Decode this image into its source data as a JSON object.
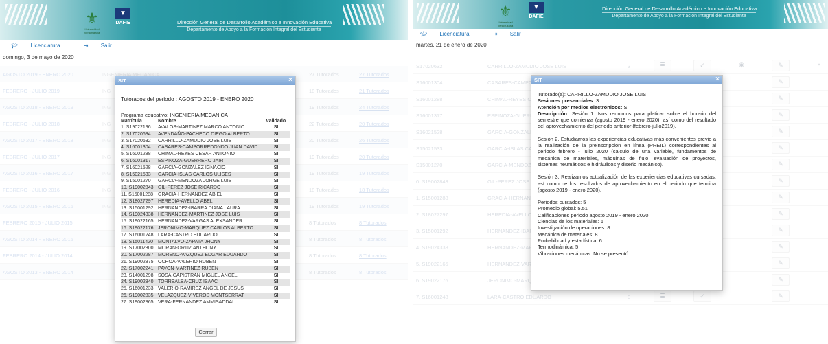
{
  "left": {
    "banner": {
      "title": "Dirección General de Desarrollo Académico e Innovación Educativa",
      "subtitle": "Departamento de Apoyo a la Formación Integral del Estudiante",
      "univ_caption": "Universidad Veracruzana",
      "dafie": "DAFIE"
    },
    "nav": {
      "licenciatura": "Licenciatura",
      "salir": "Salir"
    },
    "date": "domingo, 3 de mayo de 2020",
    "bg_rows": [
      {
        "period": "AGOSTO 2019 - ENERO 2020",
        "prog": "INGENIERIA MECANICA",
        "tut": "27 Tutorados",
        "link": "27 Tutorados"
      },
      {
        "period": "FEBRERO - JULIO 2019",
        "prog": "ING",
        "tut": "18 Tutorados",
        "link": "21 Tutorados"
      },
      {
        "period": "AGOSTO 2018 - ENERO 2019",
        "prog": "ING",
        "tut": "19 Tutorados",
        "link": "24 Tutorados"
      },
      {
        "period": "FEBRERO - JULIO 2018",
        "prog": "ING",
        "tut": "22 Tutorados",
        "link": "20 Tutorados"
      },
      {
        "period": "AGOSTO 2017 - ENERO 2018",
        "prog": "ING",
        "tut": "20 Tutorados",
        "link": "26 Tutorados"
      },
      {
        "period": "FEBRERO - JULIO 2017",
        "prog": "ING",
        "tut": "19 Tutorados",
        "link": "20 Tutorados"
      },
      {
        "period": "AGOSTO 2016 - ENERO 2017",
        "prog": "ING",
        "tut": "19 Tutorados",
        "link": "19 Tutorados"
      },
      {
        "period": "FEBRERO - JULIO 2016",
        "prog": "ING",
        "tut": "18 Tutorados",
        "link": "18 Tutorados"
      },
      {
        "period": "AGOSTO 2015 - ENERO 2016",
        "prog": "ING",
        "tut": "19 Tutorados",
        "link": "19 Tutorados"
      },
      {
        "period": "FEBRERO 2015 - JULIO 2015",
        "prog": "",
        "tut": "8 Tutorados",
        "link": "8 Tutorados"
      },
      {
        "period": "AGOSTO 2014 - ENERO 2015",
        "prog": "",
        "tut": "8 Tutorados",
        "link": "8 Tutorados"
      },
      {
        "period": "FEBRERO 2014 - JULIO 2014",
        "prog": "",
        "tut": "8 Tutorados",
        "link": "8 Tutorados"
      },
      {
        "period": "AGOSTO 2013 - ENERO 2014",
        "prog": "",
        "tut": "8 Tutorados",
        "link": "8 Tutorados"
      }
    ],
    "modal": {
      "header": "SIT",
      "close": "×",
      "period_label": "Tutorados del periodo : AGOSTO 2019 - ENERO 2020",
      "program_label": "Programa educativo: INGENIERIA MECANICA",
      "col_matricula": "Matrícula",
      "col_nombre": "Nombre",
      "col_validado": "validado",
      "students": [
        {
          "num": "1. S19022196",
          "name": "AVALOS-MARTINEZ MARCO ANTONIO",
          "v": "SI"
        },
        {
          "num": "2. S17020634",
          "name": "AVENDAÑO-PACHECO DIEGO ALBERTO",
          "v": "SI"
        },
        {
          "num": "3. S17020632",
          "name": "CARRILLO-ZAMUDIO JOSE LUIS",
          "v": "SI"
        },
        {
          "num": "4. S16001304",
          "name": "CASARES-CAMPORREDONDO JUAN DAVID",
          "v": "SI"
        },
        {
          "num": "5. S16001288",
          "name": "CHIMAL-REYES CESAR ANTONIO",
          "v": "SI"
        },
        {
          "num": "6. S16001317",
          "name": "ESPINOZA-GUERRERO JAIR",
          "v": "SI"
        },
        {
          "num": "7. S16021528",
          "name": "GARCIA-GONZALEZ IGNACIO",
          "v": "SI"
        },
        {
          "num": "8. S15021533",
          "name": "GARCIA-ISLAS CARLOS ULISES",
          "v": "SI"
        },
        {
          "num": "9. S15001270",
          "name": "GARCIA-MENDOZA JORGE LUIS",
          "v": "SI"
        },
        {
          "num": "10. S19002843",
          "name": "GIL-PEREZ JOSE RICARDO",
          "v": "SI"
        },
        {
          "num": "11. S15001288",
          "name": "GRACIA-HERNANDEZ ABIEL",
          "v": "SI"
        },
        {
          "num": "12. S18027297",
          "name": "HEREDIA-AVELLO ABEL",
          "v": "SI"
        },
        {
          "num": "13. S15001292",
          "name": "HERNANDEZ-IBARRA DIANA LAURA",
          "v": "SI"
        },
        {
          "num": "14. S19024338",
          "name": "HERNANDEZ-MARTINEZ JOSE LUIS",
          "v": "SI"
        },
        {
          "num": "15. S19022165",
          "name": "HERNANDEZ-VARGAS ALEXSANDER",
          "v": "SI"
        },
        {
          "num": "16. S19022176",
          "name": "JERONIMO-MARQUEZ CARLOS ALBERTO",
          "v": "SI"
        },
        {
          "num": "17. S16001248",
          "name": "LARA-CASTRO EDUARDO",
          "v": "SI"
        },
        {
          "num": "18. S15011420",
          "name": "MONTALVO-ZAPATA JHONY",
          "v": "SI"
        },
        {
          "num": "19. S17002300",
          "name": "MORAN-ORTIZ ANTHONY",
          "v": "SI"
        },
        {
          "num": "20. S17002287",
          "name": "MORENO-VAZQUEZ EDGAR EDUARDO",
          "v": "SI"
        },
        {
          "num": "21. S19002875",
          "name": "OCHOA-VALERIO RUBEN",
          "v": "SI"
        },
        {
          "num": "22. S17002241",
          "name": "PAVON-MARTINEZ RUBEN",
          "v": "SI"
        },
        {
          "num": "23. S14001298",
          "name": "SOSA-CAPISTRAN MIGUEL ANGEL",
          "v": "SI"
        },
        {
          "num": "24. S19002840",
          "name": "TORREALBA-CRUZ ISAAC",
          "v": "SI"
        },
        {
          "num": "25. S16001233",
          "name": "VALERIO-RAMIREZ ANGEL DE JESUS",
          "v": "SI"
        },
        {
          "num": "26. S19002835",
          "name": "VELAZQUEZ-VIVEROS MONTSERRAT",
          "v": "SI"
        },
        {
          "num": "27. S19002865",
          "name": "VERA-FERNANDEZ AMMISADDAI",
          "v": "SI"
        }
      ],
      "button": "Cerrar"
    }
  },
  "right": {
    "banner": {
      "title": "Dirección General de Desarrollo Académico e Innovación Educativa",
      "subtitle": "Departamento de Apoyo a la Formación Integral del Estudiante",
      "univ_caption": "Universidad Veracruzana",
      "dafie": "DAFIE"
    },
    "nav": {
      "licenciatura": "Licenciatura",
      "salir": "Salir"
    },
    "date": "martes, 21 de enero de 2020",
    "rows": [
      {
        "mat": "S17020632",
        "name": "CARRILLO-ZAMUDIO JOSE LUIS",
        "ses": "3"
      },
      {
        "mat": "S16001304",
        "name": "CASARES-CAMPORRED",
        "ses": ""
      },
      {
        "mat": "S16001288",
        "name": "CHIMAL-REYES CESAR A",
        "ses": ""
      },
      {
        "mat": "S16001317",
        "name": "ESPINOZA-GUERRERO J",
        "ses": ""
      },
      {
        "mat": "S16021528",
        "name": "GARCIA-GONZALEZ IGN",
        "ses": ""
      },
      {
        "mat": "S15021533",
        "name": "GARCIA-ISLAS CARLOS",
        "ses": ""
      },
      {
        "mat": "S15001270",
        "name": "GARCIA-MENDOZA JORG",
        "ses": ""
      },
      {
        "mat": "0. S19002843",
        "name": "GIL-PEREZ JOSE RICAR",
        "ses": ""
      },
      {
        "mat": "1. S15001288",
        "name": "GRACIA-HERNANDEZ AB",
        "ses": ""
      },
      {
        "mat": "2. S18027297",
        "name": "HEREDIA-AVELLO ABEL",
        "ses": ""
      },
      {
        "mat": "3. S15001292",
        "name": "HERNANDEZ-IBARRA DI",
        "ses": ""
      },
      {
        "mat": "4. S19024338",
        "name": "HERNANDEZ-MARTINEZ",
        "ses": ""
      },
      {
        "mat": "5. S19022165",
        "name": "HERNANDEZ-VARGAS ALEXSANDER",
        "ses": "0"
      },
      {
        "mat": "6. S19022176",
        "name": "JERONIMO-MARQUEZ CARLOS ALBERTO",
        "ses": "0"
      },
      {
        "mat": "7. S16001248",
        "name": "LARA-CASTRO EDUARDO",
        "ses": "0"
      }
    ],
    "modal": {
      "header": "SIT",
      "close": "×",
      "tutorado_label": "Tutorado(a):",
      "tutorado_name": "CARRILLO-ZAMUDIO JOSE LUIS",
      "sesiones_label": "Sesiones presenciales:",
      "sesiones_val": "3",
      "medios_label": "Atención por medios electrónicos:",
      "medios_val": "Si",
      "desc_label": "Descripción:",
      "sesion1": "Sesión 1. Nos reunimos para platicar sobre el horario del semestre que comienza (agosto 2019 - enero 2020), así como del resultado del aprovechamiento del periodo anterior (febrero-julio2019).",
      "sesion2": "Sesión 2. Estudiamos las experiencias educativas más convenientes previo a la realización de la preinscripción en línea (PREIL) correspondientes al periodo febrero - julio 2020 (calculo de una variable, fundamentos de mecánica de materiales, máquinas de flujo, evaluación de proyectos, sistemas neumáticos e hidráulicos y diseño mecánico).",
      "sesion3": "Sesión 3. Realizamos actualización de las experiencias educativas cursadas, así como de los resultados de aprovechamiento en el periodo que termina (agosto 2019 - enero 2020).",
      "stats": [
        "Periodos cursados: 5",
        "Promedio global: 5.51",
        "Calificaciones periodo agosto 2019 - enero 2020:",
        "Ciencias de los materiales: 6",
        "Investigación de operaciones: 8",
        "Mecánica de materiales: 8",
        "Probabilidad y estadística: 6",
        "Termodinámica: 5",
        "Vibraciones mecánicas: No se presentó"
      ]
    }
  }
}
